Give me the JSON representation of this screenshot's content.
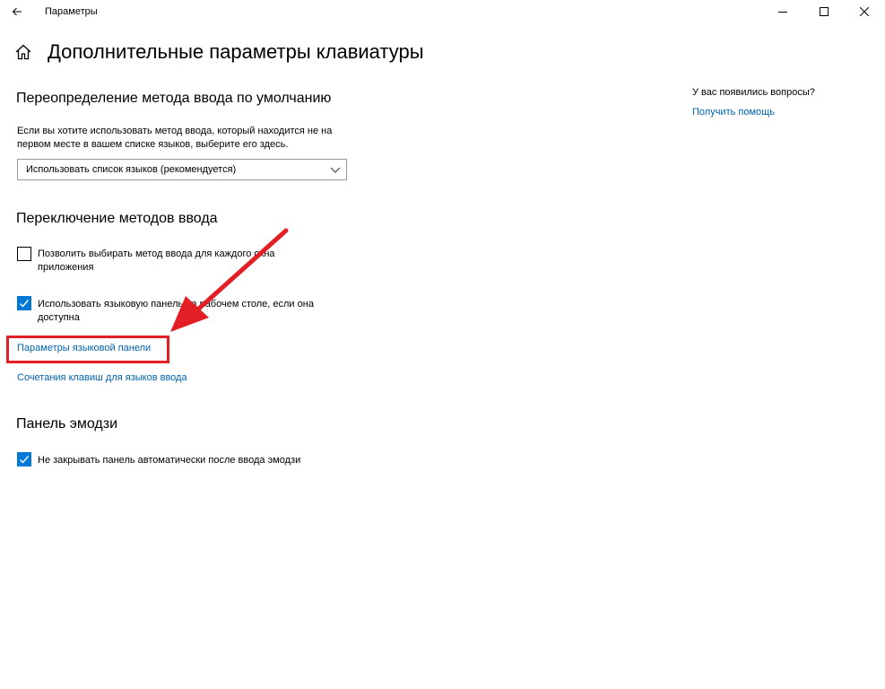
{
  "window": {
    "title": "Параметры"
  },
  "page": {
    "title": "Дополнительные параметры клавиатуры"
  },
  "sections": {
    "input_override": {
      "heading": "Переопределение метода ввода по умолчанию",
      "description_line1": "Если вы хотите использовать метод ввода, который находится не на",
      "description_line2": "первом месте в вашем списке языков, выберите его здесь.",
      "dropdown_value": "Использовать список языков (рекомендуется)"
    },
    "switching": {
      "heading": "Переключение методов ввода",
      "checkbox1": {
        "line1": "Позволить выбирать метод ввода для каждого окна",
        "line2": "приложения",
        "checked": false
      },
      "checkbox2": {
        "line1": "Использовать языковую панель на рабочем столе, если она",
        "line2": "доступна",
        "checked": true
      },
      "link_langbar": "Параметры языковой панели",
      "link_hotkeys": "Сочетания клавиш для языков ввода"
    },
    "emoji": {
      "heading": "Панель эмодзи",
      "checkbox": {
        "line1": "Не закрывать панель автоматически после ввода эмодзи",
        "checked": true
      }
    }
  },
  "help": {
    "question": "У вас появились вопросы?",
    "link": "Получить помощь"
  },
  "colors": {
    "accent": "#0078d7",
    "link": "#0063b1",
    "highlight": "#e31e24"
  },
  "icons": {
    "back": "back-arrow-icon",
    "home": "home-icon",
    "minimize": "minimize-icon",
    "maximize": "maximize-icon",
    "close": "close-icon",
    "chevron": "chevron-down-icon",
    "check": "checkmark-icon"
  }
}
